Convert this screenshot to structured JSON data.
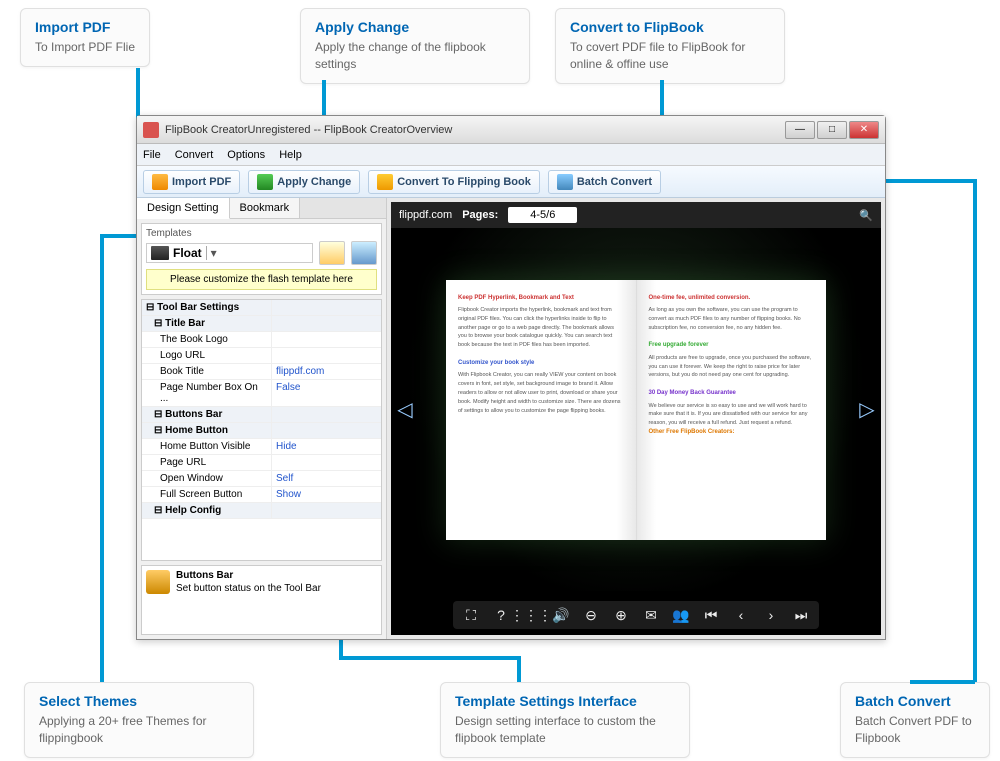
{
  "callouts": {
    "import": {
      "title": "Import PDF",
      "desc": "To Import PDF Flie"
    },
    "apply": {
      "title": "Apply Change",
      "desc": "Apply the change of the flipbook settings"
    },
    "convert": {
      "title": "Convert to FlipBook",
      "desc": "To covert PDF file to FlipBook for online & offine use"
    },
    "themes": {
      "title": "Select Themes",
      "desc": "Applying a 20+ free Themes for flippingbook"
    },
    "template": {
      "title": "Template Settings Interface",
      "desc": "Design setting interface to custom the flipbook template"
    },
    "batch": {
      "title": "Batch Convert",
      "desc": "Batch Convert PDF to Flipbook"
    }
  },
  "window": {
    "title": "FlipBook CreatorUnregistered -- FlipBook CreatorOverview"
  },
  "menubar": [
    "File",
    "Convert",
    "Options",
    "Help"
  ],
  "toolbar": {
    "import": "Import PDF",
    "apply": "Apply Change",
    "convert": "Convert To Flipping Book",
    "batch": "Batch Convert"
  },
  "sidebar": {
    "tabs": [
      "Design Setting",
      "Bookmark"
    ],
    "templates_label": "Templates",
    "theme_name": "Float",
    "customize_note": "Please customize the flash template here",
    "props": [
      {
        "type": "grp",
        "k": "Tool Bar Settings",
        "v": ""
      },
      {
        "type": "sub",
        "k": "Title Bar",
        "v": ""
      },
      {
        "type": "row",
        "k": "The Book Logo",
        "v": ""
      },
      {
        "type": "row",
        "k": "Logo URL",
        "v": ""
      },
      {
        "type": "row",
        "k": "Book Title",
        "v": "flippdf.com"
      },
      {
        "type": "row",
        "k": "Page Number Box On ...",
        "v": "False"
      },
      {
        "type": "sub",
        "k": "Buttons Bar",
        "v": ""
      },
      {
        "type": "sub",
        "k": "Home Button",
        "v": ""
      },
      {
        "type": "row",
        "k": "Home Button Visible",
        "v": "Hide"
      },
      {
        "type": "row",
        "k": "Page URL",
        "v": ""
      },
      {
        "type": "row",
        "k": "Open Window",
        "v": "Self"
      },
      {
        "type": "row",
        "k": "Full Screen Button",
        "v": "Show"
      },
      {
        "type": "sub",
        "k": "Help Config",
        "v": ""
      }
    ],
    "desc": {
      "title": "Buttons Bar",
      "text": "Set button status on the Tool Bar"
    }
  },
  "preview": {
    "brand": "flippdf.com",
    "pages_label": "Pages:",
    "pages_value": "4-5/6",
    "left_page": {
      "h1": "Keep PDF Hyperlink, Bookmark and Text",
      "h2": "Customize your book style"
    },
    "right_page": {
      "h1": "One-time fee, unlimited conversion.",
      "h2": "Free upgrade forever",
      "h3": "30 Day Money Back Guarantee",
      "h4": "Other Free FlipBook Creators:"
    }
  }
}
